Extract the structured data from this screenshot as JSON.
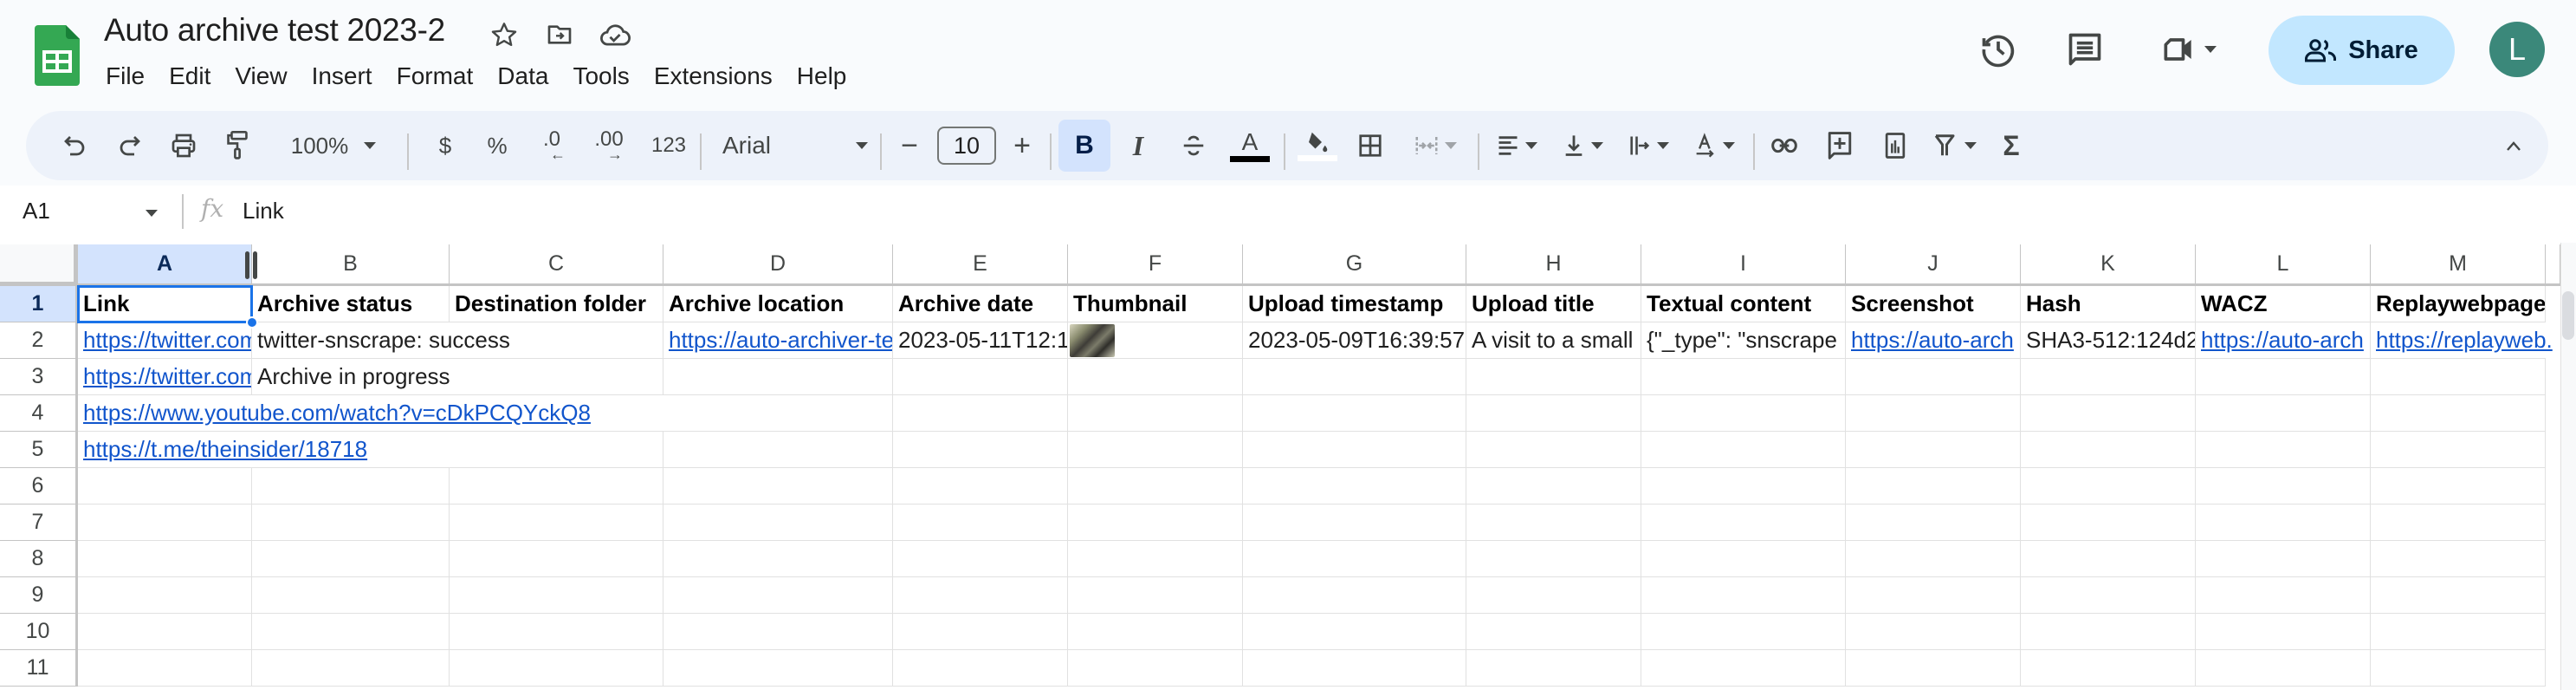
{
  "header": {
    "doc_title": "Auto archive test 2023-2",
    "title_icons": [
      "star-icon",
      "move-to-folder-icon",
      "cloud-saved-icon"
    ],
    "menu": [
      "File",
      "Edit",
      "View",
      "Insert",
      "Format",
      "Data",
      "Tools",
      "Extensions",
      "Help"
    ],
    "share_label": "Share",
    "avatar_initial": "L",
    "right_icons": [
      "version-history-icon",
      "comments-icon",
      "meet-icon"
    ]
  },
  "toolbar": {
    "zoom": "100%",
    "currency": "$",
    "percent": "%",
    "decrease_decimals": ".0",
    "increase_decimals": ".00",
    "number_format": "123",
    "font": "Arial",
    "font_size": "10",
    "bold": "B",
    "italic": "I",
    "text_color": "A",
    "text_color_value": "#000000",
    "fill_color_value": "#ffffff"
  },
  "formula_bar": {
    "name_box": "A1",
    "fx": "fx",
    "value": "Link"
  },
  "grid": {
    "columns": [
      "A",
      "B",
      "C",
      "D",
      "E",
      "F",
      "G",
      "H",
      "I",
      "J",
      "K",
      "L",
      "M"
    ],
    "selected_column": "A",
    "selected_cell": "A1",
    "rows": [
      "1",
      "2",
      "3",
      "4",
      "5",
      "6",
      "7",
      "8",
      "9",
      "10",
      "11"
    ],
    "cells": {
      "r1": [
        "Link",
        "Archive status",
        "Destination folder",
        "Archive location",
        "Archive date",
        "Thumbnail",
        "Upload timestamp",
        "Upload title",
        "Textual content",
        "Screenshot",
        "Hash",
        "WACZ",
        "Replaywebpage"
      ],
      "r2": [
        "https://twitter.com",
        "twitter-snscrape: success",
        "",
        "https://auto-archiver-te",
        "2023-05-11T12:1",
        "[thumbnail-image]",
        "2023-05-09T16:39:57",
        "A visit to a small",
        "{\"_type\": \"snscrape",
        "https://auto-arch",
        "SHA3-512:124d2",
        "https://auto-arch",
        "https://replayweb."
      ],
      "r3": [
        "https://twitter.com",
        "Archive in progress"
      ],
      "r4": [
        "https://www.youtube.com/watch?v=cDkPCQYckQ8"
      ],
      "r5": [
        "https://t.me/theinsider/18718"
      ]
    }
  },
  "colors": {
    "accent": "#1a73e8",
    "link": "#1155cc",
    "share_bg": "#c2e7ff",
    "avatar_bg": "#3b887a",
    "sheets_green": "#34a853"
  }
}
